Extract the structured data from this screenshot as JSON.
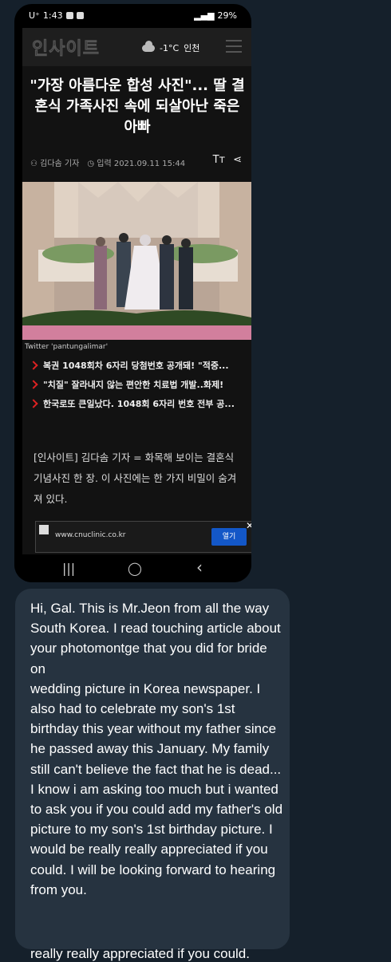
{
  "status_bar": {
    "carrier": "U⁺",
    "time": "1:43",
    "battery": "29%"
  },
  "site": {
    "logo": "인사이트",
    "temperature": "-1°C",
    "location": "인천"
  },
  "article": {
    "headline": "\"가장 아름다운 합성 사진\"... 딸 결혼식 가족사진 속에 되살아난 죽은 아빠",
    "author": "김다솜 기자",
    "date": "입력 2021.09.11 15:44",
    "font_tool": "Tт",
    "photo_caption": "Twitter 'pantungalimar'",
    "related": [
      "복권 1048회차 6자리 당첨번호 공개돼! \"적중...",
      "\"치질\" 잘라내지 않는 편안한 치료법 개발..화제!",
      "한국로또 큰일났다. 1048회 6자리 번호 전부 공..."
    ],
    "body": "[인사이트] 김다솜 기자 = 화목해 보이는 결혼식 기념사진 한 장. 이 사진에는 한 가지 비밀이 숨겨져 있다."
  },
  "ad": {
    "url": "www.cnuclinic.co.kr",
    "button": "열기",
    "close": "✕"
  },
  "navbar": {
    "recents": "|||",
    "home": "◯",
    "back": "‹"
  },
  "message": {
    "text": "Hi, Gal. This is Mr.Jeon from all the way South Korea. I read touching article about your photomontge that you did for bride on\nwedding picture in Korea newspaper. I also had to celebrate my son's 1st birthday this year without my father since he passed away  this January. My family still can't believe the fact that he is dead... I know i am asking too much but i wanted to ask you if you could add my father's old picture to my son's 1st birthday picture. I would be really really appreciated if you could. I will be looking forward to hearing from you.",
    "cut_off_line": "really really appreciated if you could."
  }
}
